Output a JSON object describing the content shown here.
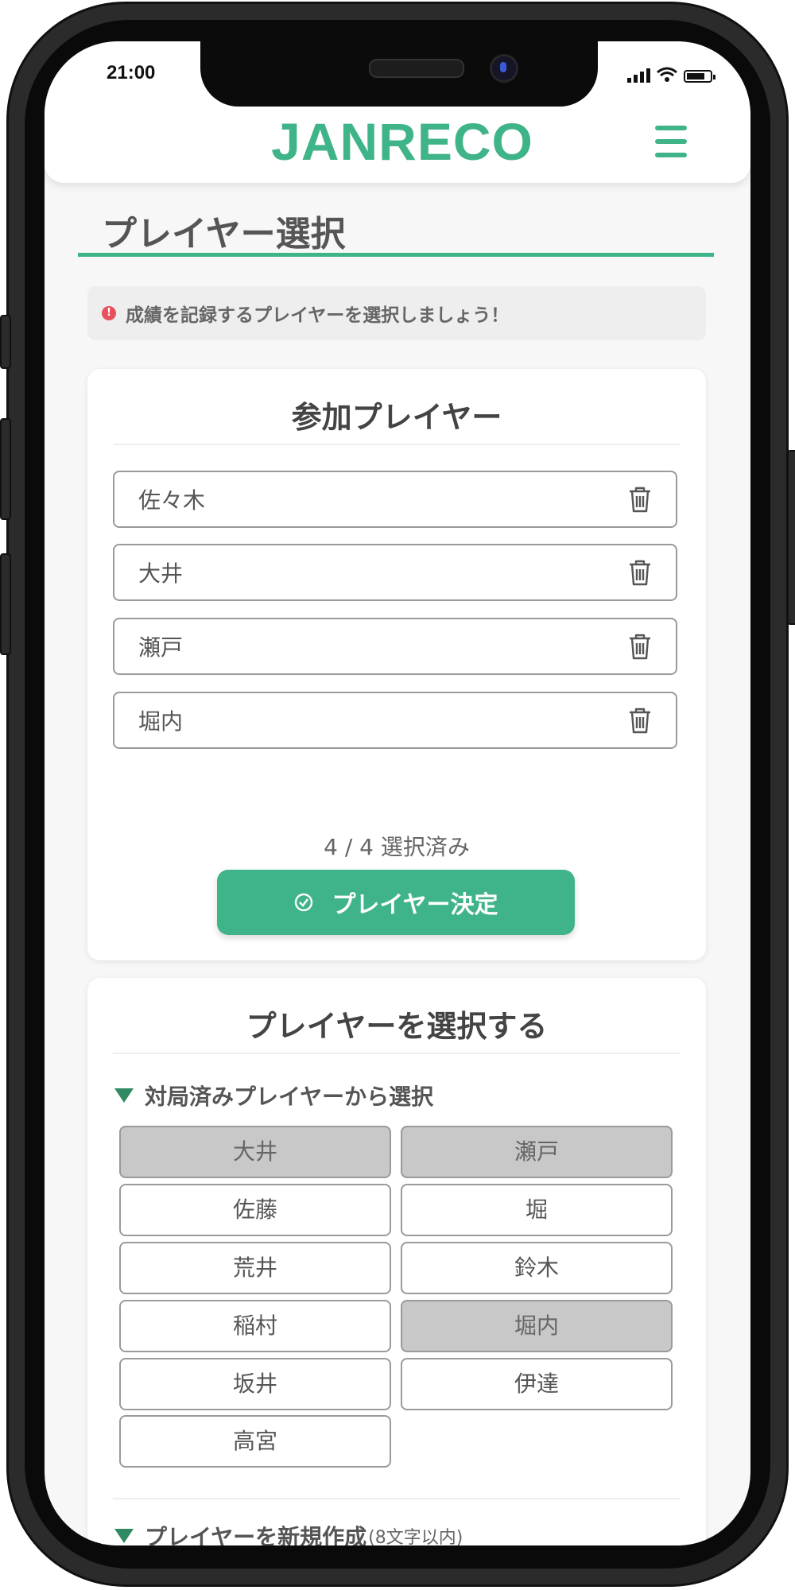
{
  "status_bar": {
    "time": "21:00"
  },
  "header": {
    "logo": "JANRECO"
  },
  "page": {
    "title": "プレイヤー選択",
    "notice": "成績を記録するプレイヤーを選択しましょう！",
    "notice_icon": "!"
  },
  "participants": {
    "title": "参加プレイヤー",
    "players": [
      {
        "name": "佐々木"
      },
      {
        "name": "大井"
      },
      {
        "name": "瀬戸"
      },
      {
        "name": "堀内"
      }
    ],
    "selected_count": "4 / 4 選択済み",
    "confirm_label": "プレイヤー決定"
  },
  "select": {
    "title": "プレイヤーを選択する",
    "history_label": "対局済みプレイヤーから選択",
    "history_players": [
      {
        "name": "大井",
        "selected": true
      },
      {
        "name": "瀬戸",
        "selected": true
      },
      {
        "name": "佐藤",
        "selected": false
      },
      {
        "name": "堀",
        "selected": false
      },
      {
        "name": "荒井",
        "selected": false
      },
      {
        "name": "鈴木",
        "selected": false
      },
      {
        "name": "稲村",
        "selected": false
      },
      {
        "name": "堀内",
        "selected": true
      },
      {
        "name": "坂井",
        "selected": false
      },
      {
        "name": "伊達",
        "selected": false
      },
      {
        "name": "高宮",
        "selected": false
      }
    ],
    "new_label": "プレイヤーを新規作成",
    "new_hint": "(8文字以内)"
  },
  "colors": {
    "accent": "#3fb488",
    "selected_bg": "#c8c8c8",
    "notice_icon": "#e8505b"
  }
}
